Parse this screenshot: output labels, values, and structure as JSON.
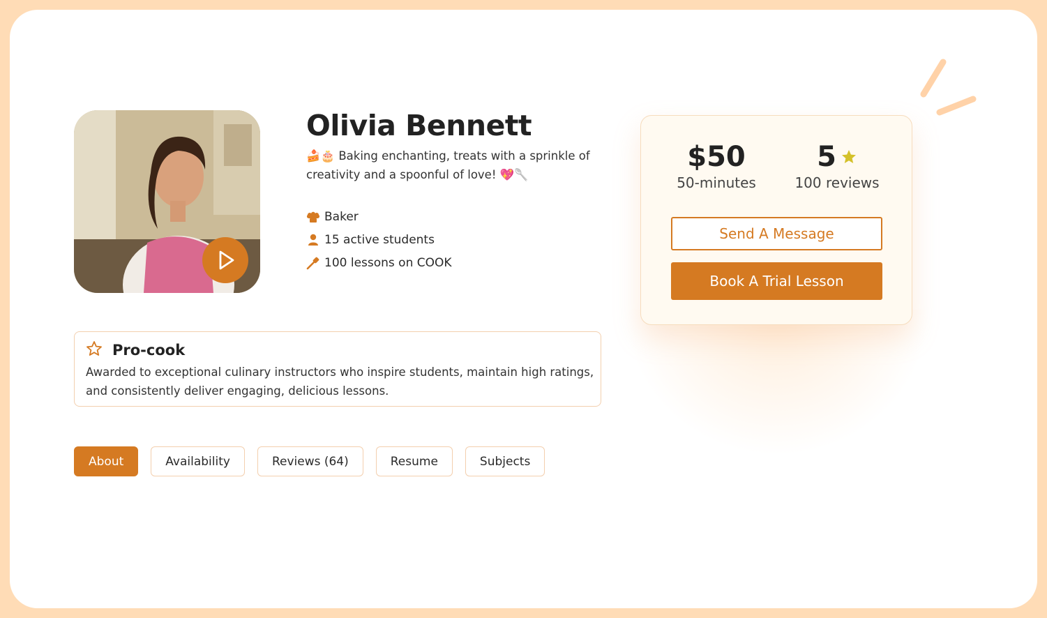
{
  "profile": {
    "name": "Olivia Bennett",
    "tagline": "🍰🎂 Baking enchanting, treats with a sprinkle of creativity and a spoonful of love! 💖🥄",
    "facts": [
      {
        "icon": "chef-hat-icon",
        "label": "Baker"
      },
      {
        "icon": "person-icon",
        "label": "15 active students"
      },
      {
        "icon": "spatula-icon",
        "label": "100 lessons on COOK"
      }
    ]
  },
  "badge": {
    "icon": "star-outline-icon",
    "title": "Pro-cook",
    "description": "Awarded to exceptional culinary instructors who inspire students, maintain high ratings, and consistently deliver engaging, delicious lessons."
  },
  "tabs": [
    {
      "label": "About",
      "active": true
    },
    {
      "label": "Availability",
      "active": false
    },
    {
      "label": "Reviews (64)",
      "active": false
    },
    {
      "label": "Resume",
      "active": false
    },
    {
      "label": "Subjects",
      "active": false
    }
  ],
  "pricing": {
    "price": "$50",
    "duration": "50-minutes",
    "rating": "5",
    "reviews": "100 reviews",
    "message_button": "Send A Message",
    "book_button": "Book A Trial Lesson"
  },
  "colors": {
    "accent": "#d57a22",
    "frame": "#ffdcb6",
    "star": "#d4c12a"
  }
}
